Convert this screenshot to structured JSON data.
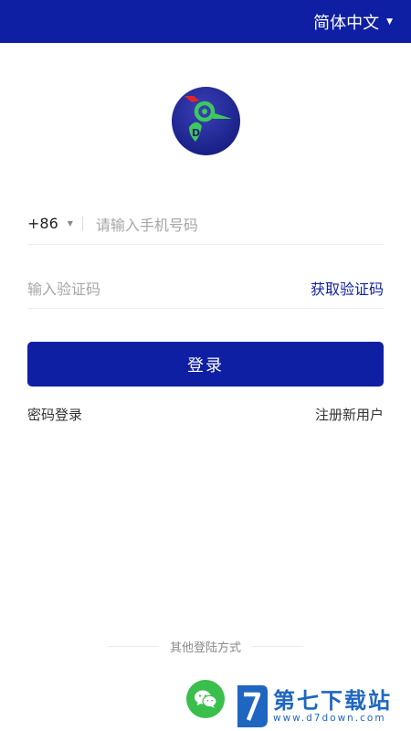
{
  "header": {
    "language_label": "简体中文",
    "language_caret_icon": "caret-down-icon",
    "bg_color": "#0f1fa3"
  },
  "logo": {
    "icon": "bird-logo-icon",
    "letter": "D"
  },
  "phone": {
    "country_code": "+86",
    "country_caret_icon": "caret-down-icon",
    "placeholder": "请输入手机号码"
  },
  "verification": {
    "placeholder": "输入验证码",
    "get_code_label": "获取验证码"
  },
  "login_button": {
    "label": "登录",
    "color": "#0f1fa3"
  },
  "links": {
    "password_login": "密码登录",
    "register": "注册新用户"
  },
  "other_login": {
    "label": "其他登陆方式",
    "wechat_icon": "wechat-icon",
    "wechat_color": "#3bbf4c"
  },
  "watermark": {
    "title": "第七下载站",
    "url": "www.d7down.com",
    "color": "#1f66c1"
  }
}
